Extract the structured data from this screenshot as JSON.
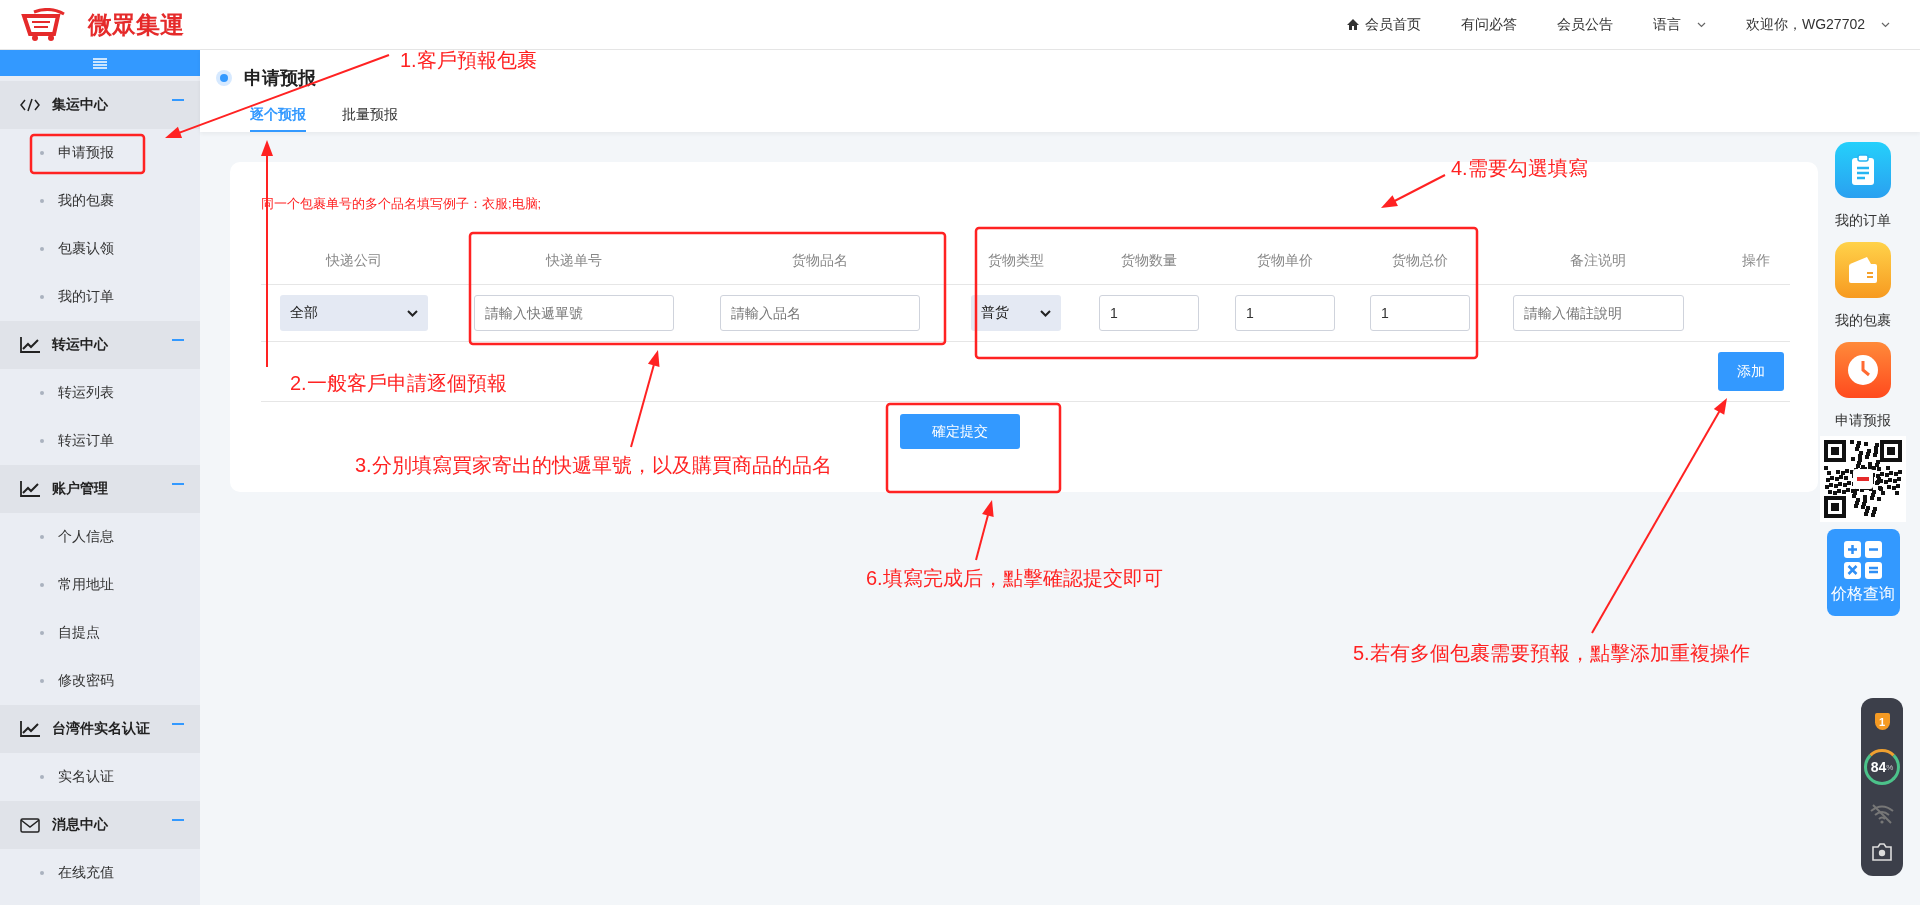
{
  "header": {
    "logo_text": "微眾集運",
    "nav": [
      {
        "label": "会员首页",
        "kind": "home"
      },
      {
        "label": "有问必答",
        "kind": "plain"
      },
      {
        "label": "会员公告",
        "kind": "plain"
      },
      {
        "label": "语言",
        "kind": "dropdown"
      },
      {
        "label": "欢迎你，WG27702",
        "kind": "dropdown"
      }
    ]
  },
  "sidebar": {
    "groups": [
      {
        "label": "集运中心",
        "kind": "code",
        "items": [
          "申请预报",
          "我的包裹",
          "包裹认领",
          "我的订单"
        ]
      },
      {
        "label": "转运中心",
        "kind": "chart",
        "items": [
          "转运列表",
          "转运订单"
        ]
      },
      {
        "label": "账户管理",
        "kind": "chart",
        "items": [
          "个人信息",
          "常用地址",
          "自提点",
          "修改密码"
        ]
      },
      {
        "label": "台湾件实名认证",
        "kind": "chart",
        "items": [
          "实名认证"
        ]
      },
      {
        "label": "消息中心",
        "kind": "mail",
        "items": [
          "在线充值"
        ]
      }
    ]
  },
  "page": {
    "title": "申请预报",
    "tabs": [
      {
        "label": "逐个预报",
        "selected": true
      },
      {
        "label": "批量预报",
        "selected": false
      }
    ]
  },
  "form": {
    "note": "同一个包裹单号的多个品名填写例子：衣服;电脑;",
    "columns": [
      "快递公司",
      "快递单号",
      "货物品名",
      "货物类型",
      "货物数量",
      "货物单价",
      "货物总价",
      "备注说明",
      "操作"
    ],
    "row": [
      {
        "kind": "select",
        "value": "全部"
      },
      {
        "kind": "input",
        "placeholder": "請輸入快遞單號"
      },
      {
        "kind": "input",
        "placeholder": "請輸入品名"
      },
      {
        "kind": "select",
        "value": "普货"
      },
      {
        "kind": "input",
        "value": "1"
      },
      {
        "kind": "input",
        "value": "1"
      },
      {
        "kind": "input",
        "value": "1"
      },
      {
        "kind": "input",
        "placeholder": "請輸入備註說明"
      },
      {
        "kind": "empty"
      }
    ],
    "add_button": "添加",
    "submit_button": "確定提交"
  },
  "quick_links": [
    {
      "label": "我的订单",
      "kind": "clipboard"
    },
    {
      "label": "我的包裹",
      "kind": "wallet"
    },
    {
      "label": "申请预报",
      "kind": "clock"
    }
  ],
  "price_button": "价格查询",
  "monitor": {
    "badge": "1",
    "percent": "84",
    "unit": "%"
  },
  "annotations": [
    "1.客戶預報包裹",
    "2.一般客戶申請逐個預報",
    "3.分別填寫買家寄出的快遞單號，以及購買商品的品名",
    "4.需要勾選填寫",
    "5.若有多個包裹需要預報，點擊添加重複操作",
    "6.填寫完成后，點擊確認提交即可"
  ]
}
